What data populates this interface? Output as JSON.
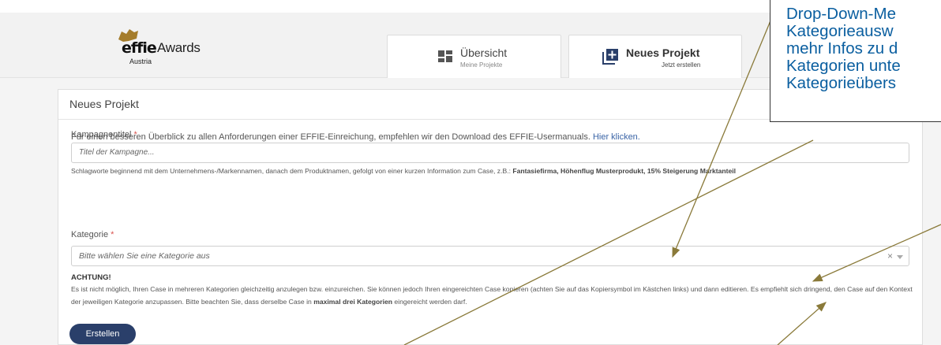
{
  "logo": {
    "brand": "effie",
    "suffix": "Awards",
    "region": "Austria"
  },
  "nav": [
    {
      "title": "Übersicht",
      "subtitle": "Meine Projekte",
      "icon": "dashboard-icon"
    },
    {
      "title": "Neues Projekt",
      "subtitle": "Jetzt erstellen",
      "icon": "add-project-icon"
    }
  ],
  "panel": {
    "title": "Neues Projekt",
    "intro_text": "Für einen besseren Überblick zu allen Anforderungen einer EFFIE-Einreichung, empfehlen wir den Download des EFFIE-Usermanuals.",
    "intro_link": "Hier klicken."
  },
  "form": {
    "campaign_label": "Kampagnentitel",
    "required_mark": "*",
    "campaign_placeholder": "Titel der Kampagne...",
    "campaign_hint": "Schlagworte beginnend mit dem Unternehmens-/Markennamen, danach dem Produktnamen, gefolgt von einer kurzen Information zum Case, z.B.:",
    "campaign_hint_example": "Fantasiefirma, Höhenflug Musterprodukt, 15% Steigerung Marktanteil",
    "category_label": "Kategorie",
    "category_placeholder": "Bitte wählen Sie eine Kategorie aus",
    "clear_symbol": "×",
    "warning_title": "ACHTUNG!",
    "warning_text_1": "Es ist nicht möglich, Ihren Case in mehreren Kategorien gleichzeitig anzulegen bzw. einzureichen. Sie können jedoch Ihren eingereichten Case kopieren (achten Sie auf das Kopiersymbol im Kästchen links) und dann editieren. Es empfiehlt sich dringend, den Case auf den Kontext der jeweiligen Kategorie anzupassen. Bitte beachten Sie, dass derselbe Case in",
    "warning_bold": "maximal drei Kategorien",
    "warning_text_2": "eingereicht werden darf.",
    "submit_label": "Erstellen"
  },
  "callout": {
    "lines": [
      "Drop-Down-Me",
      "Kategorieausw",
      "mehr Infos zu d",
      "Kategorien unte",
      "Kategorieübers"
    ]
  },
  "colors": {
    "header_bg": "#f2f2f2",
    "link": "#3a64a6",
    "button": "#2a3f6a",
    "required": "#d9534f",
    "callout_text": "#0b5fa0",
    "arrow": "#8a7a3a",
    "logo_gold": "#a57d2c"
  }
}
